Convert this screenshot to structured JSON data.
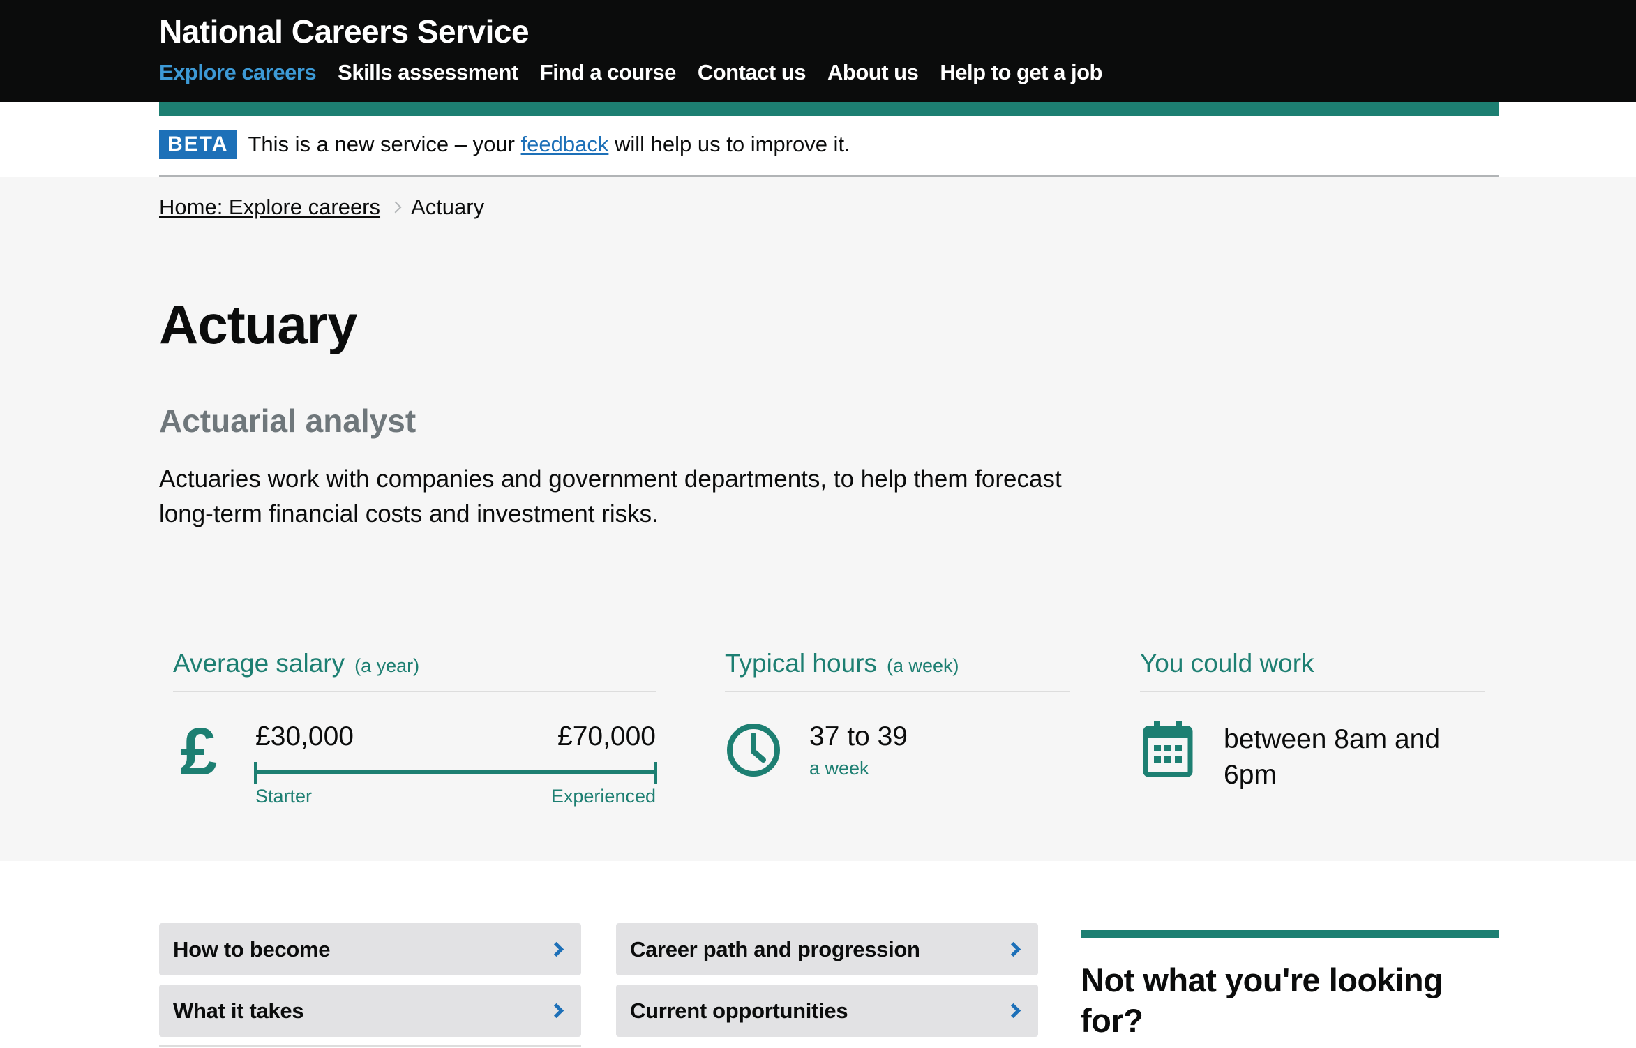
{
  "header": {
    "service_name": "National Careers Service",
    "nav": [
      {
        "label": "Explore careers"
      },
      {
        "label": "Skills assessment"
      },
      {
        "label": "Find a course"
      },
      {
        "label": "Contact us"
      },
      {
        "label": "About us"
      },
      {
        "label": "Help to get a job"
      }
    ]
  },
  "beta": {
    "tag": "BETA",
    "text_before": "This is a new service – your ",
    "link": "feedback",
    "text_after": " will help us to improve it."
  },
  "breadcrumb": {
    "home": "Home: Explore careers",
    "current": "Actuary"
  },
  "career": {
    "title": "Actuary",
    "alternative_title": "Actuarial analyst",
    "description": "Actuaries work with companies and government departments, to help them forecast long-term financial costs and investment risks."
  },
  "salary": {
    "heading": "Average salary",
    "period": "(a year)",
    "icon": "pound-icon",
    "starter_value": "£30,000",
    "experienced_value": "£70,000",
    "starter_label": "Starter",
    "experienced_label": "Experienced"
  },
  "hours": {
    "heading": "Typical hours",
    "period": "(a week)",
    "icon": "clock-icon",
    "value": "37 to 39",
    "sub": "a week"
  },
  "work": {
    "heading": "You could work",
    "icon": "calendar-icon",
    "value": "between 8am and 6pm"
  },
  "sections": [
    {
      "label": "How to become"
    },
    {
      "label": "Career path and progression"
    },
    {
      "label": "What it takes"
    },
    {
      "label": "Current opportunities"
    }
  ],
  "sidebar": {
    "title": "Not what you're looking for?"
  },
  "colors": {
    "header_bg": "#0b0c0c",
    "accent_teal": "#1d7f72",
    "link_blue": "#1d70b8",
    "nav_active": "#3d9ad6",
    "hero_bg": "#f6f6f6"
  }
}
